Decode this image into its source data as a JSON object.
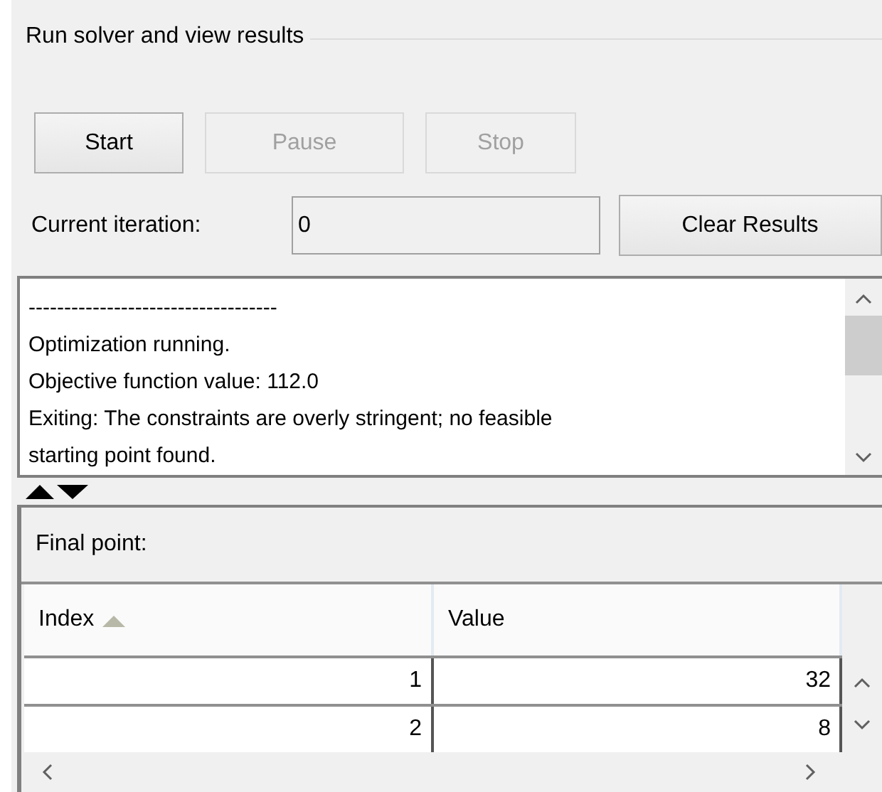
{
  "group": {
    "title": "Run solver and view results"
  },
  "buttons": [
    {
      "label": "Start",
      "disabled": false
    },
    {
      "label": "Pause",
      "disabled": true
    },
    {
      "label": "Stop",
      "disabled": true
    }
  ],
  "iteration": {
    "label": "Current iteration:",
    "value": "0"
  },
  "clear_button": {
    "label": "Clear Results"
  },
  "log": {
    "lines": [
      "-----------------------------------",
      "Optimization running.",
      "Objective function value: 112.0",
      "Exiting: The constraints are overly stringent; no feasible",
      "starting point found."
    ]
  },
  "final_point": {
    "title": "Final point:",
    "columns": [
      {
        "label": "Index",
        "sorted": true
      },
      {
        "label": "Value",
        "sorted": false
      }
    ],
    "rows": [
      [
        "1",
        "32"
      ],
      [
        "2",
        "8"
      ]
    ]
  }
}
